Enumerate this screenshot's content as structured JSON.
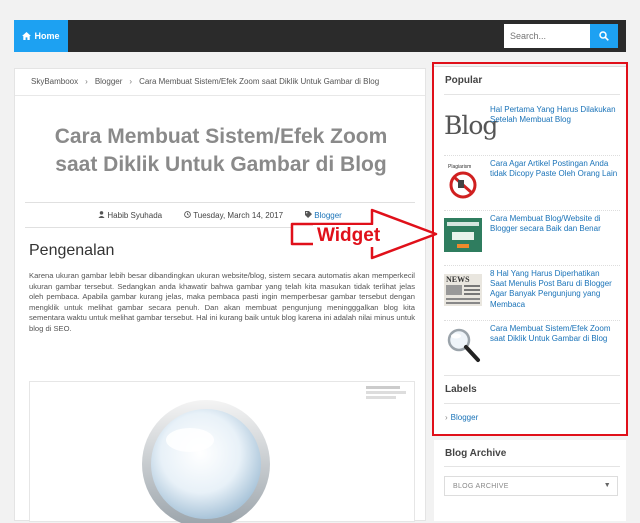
{
  "topbar": {
    "home_label": "Home",
    "search_placeholder": "Search..."
  },
  "breadcrumb": [
    "SkyBamboox",
    "Blogger",
    "Cara Membuat Sistem/Efek Zoom saat Diklik Untuk Gambar di Blog"
  ],
  "post": {
    "title": "Cara Membuat Sistem/Efek Zoom saat Diklik Untuk Gambar di Blog",
    "author": "Habib Syuhada",
    "date": "Tuesday, March 14, 2017",
    "label": "Blogger",
    "heading": "Pengenalan",
    "paragraph": "Karena ukuran gambar lebih besar dibandingkan ukuran website/blog, sistem secara automatis akan memperkecil ukuran gambar tersebut. Sedangkan anda khawatir bahwa gambar yang telah kita masukan tidak terlihat jelas oleh pembaca. Apabila gambar kurang jelas, maka pembaca pasti ingin memperbesar gambar tersebut dengan mengklik untuk melihat gambar secara penuh. Dan akan membuat pengunjung meningggalkan blog kita sementara waktu untuk melihat gambar tersebut. Hal ini kurang baik untuk blog karena ini adalah nilai minus untuk blog di SEO."
  },
  "sidebar": {
    "popular_title": "Popular",
    "popular_items": [
      {
        "title": "Hal Pertama Yang Harus Dilakukan Setelah Membuat Blog",
        "thumb": "blog-text-icon"
      },
      {
        "title": "Cara Agar Artikel Postingan Anda tidak Dicopy Paste Oleh Orang Lain",
        "thumb": "no-copy-icon"
      },
      {
        "title": "Cara Membuat Blog/Website di Blogger secara Baik dan Benar",
        "thumb": "blogger-screenshot-icon"
      },
      {
        "title": "8 Hal Yang Harus Diperhatikan Saat Menulis Post Baru di Blogger Agar Banyak Pengunjung yang Membaca",
        "thumb": "newspaper-icon"
      },
      {
        "title": "Cara Membuat Sistem/Efek Zoom saat Diklik Untuk Gambar di Blog",
        "thumb": "magnifier-icon"
      }
    ],
    "labels_title": "Labels",
    "labels_items": [
      "Blogger"
    ],
    "archive_title": "Blog Archive",
    "archive_select": "BLOG ARCHIVE"
  },
  "annotation": {
    "text": "Widget",
    "color": "#e0101a"
  },
  "colors": {
    "accent": "#1da1f2",
    "link": "#1a73b8",
    "topbar": "#2b2b2b"
  }
}
